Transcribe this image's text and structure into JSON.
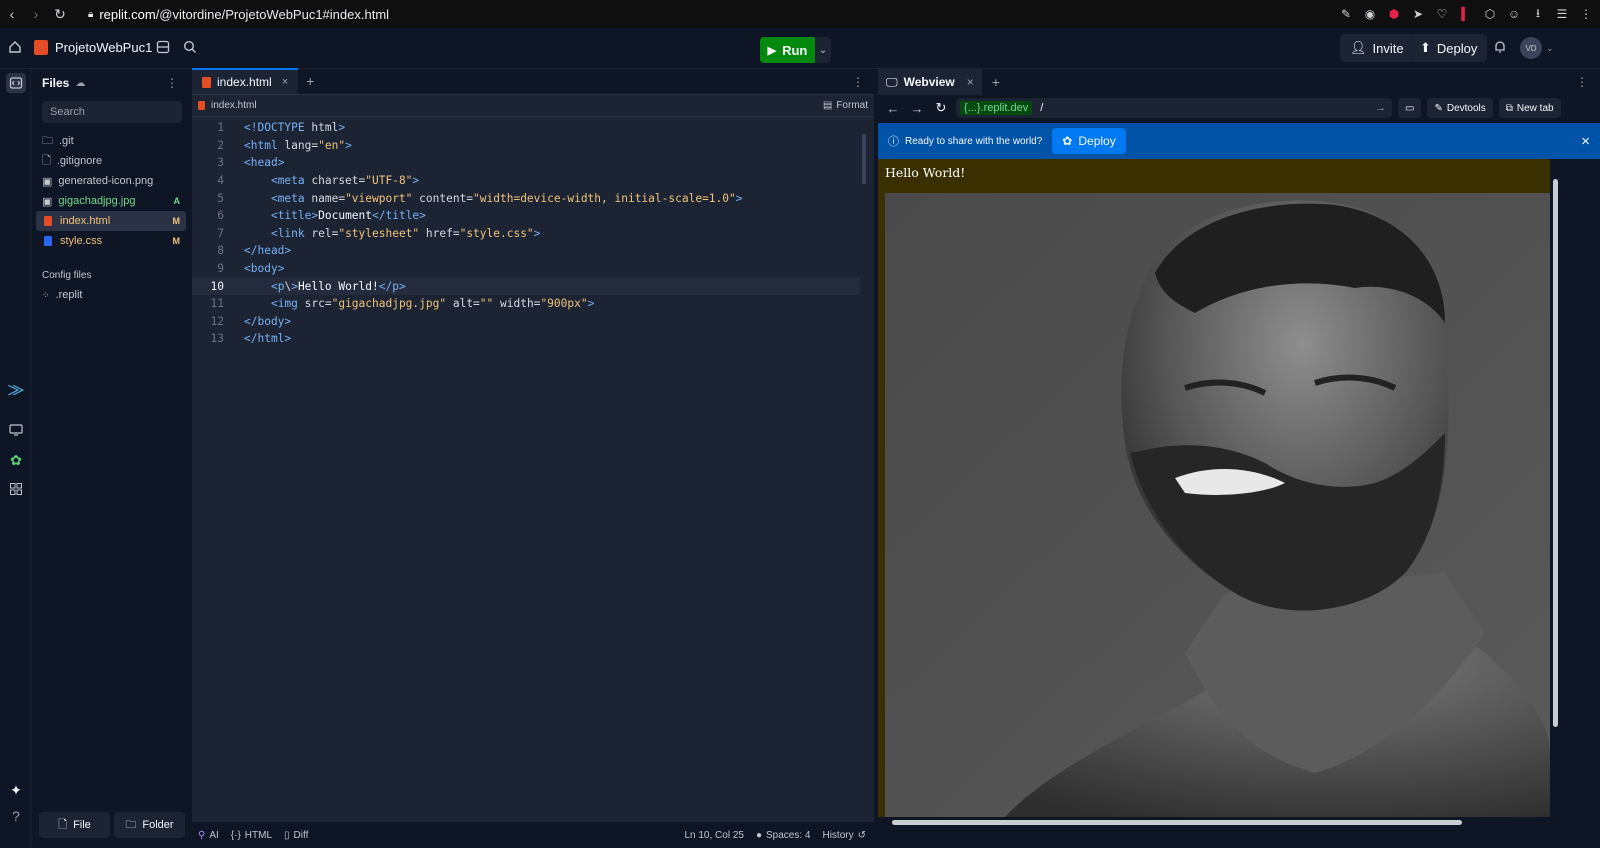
{
  "browser": {
    "url_host": "replit.com",
    "url_path": "/@vitordine/ProjetoWebPuc1#index.html"
  },
  "topbar": {
    "project_name": "ProjetoWebPuc1",
    "run_label": "Run",
    "invite_label": "Invite",
    "deploy_label": "Deploy",
    "avatar_initials": "VD"
  },
  "files": {
    "title": "Files",
    "search_placeholder": "Search",
    "items": [
      {
        "name": ".git",
        "badge": "",
        "color": "#c2c8cc"
      },
      {
        "name": ".gitignore",
        "badge": "",
        "color": "#c2c8cc"
      },
      {
        "name": "generated-icon.png",
        "badge": "",
        "color": "#c2c8cc"
      },
      {
        "name": "gigachadjpg.jpg",
        "badge": "A",
        "color": "#73dc8c"
      },
      {
        "name": "index.html",
        "badge": "M",
        "color": "#f0c379"
      },
      {
        "name": "style.css",
        "badge": "M",
        "color": "#f0c379"
      }
    ],
    "config_title": "Config files",
    "config_items": [
      ".replit"
    ],
    "new_file_label": "File",
    "new_folder_label": "Folder"
  },
  "editor": {
    "tab_label": "index.html",
    "breadcrumb": "index.html",
    "format_label": "Format",
    "current_line": 10,
    "lines": [
      "<!DOCTYPE html>",
      "<html lang=\"en\">",
      "<head>",
      "    <meta charset=\"UTF-8\">",
      "    <meta name=\"viewport\" content=\"width=device-width, initial-scale=1.0\">",
      "    <title>Document</title>",
      "    <link rel=\"stylesheet\" href=\"style.css\">",
      "</head>",
      "<body>",
      "    <p\\>Hello World!</p>",
      "    <img src=\"gigachadjpg.jpg\" alt=\"\" width=\"900px\">",
      "</body>",
      "</html>"
    ],
    "status": {
      "ai": "AI",
      "lang": "HTML",
      "diff": "Diff",
      "position": "Ln 10, Col 25",
      "spaces": "Spaces: 4",
      "history": "History"
    }
  },
  "webview": {
    "tab_label": "Webview",
    "domain": "{...}.replit.dev",
    "path": "/",
    "devtools_label": "Devtools",
    "newtab_label": "New tab",
    "banner_text": "Ready to share with the world?",
    "banner_deploy": "Deploy",
    "page_text": "Hello World!"
  }
}
